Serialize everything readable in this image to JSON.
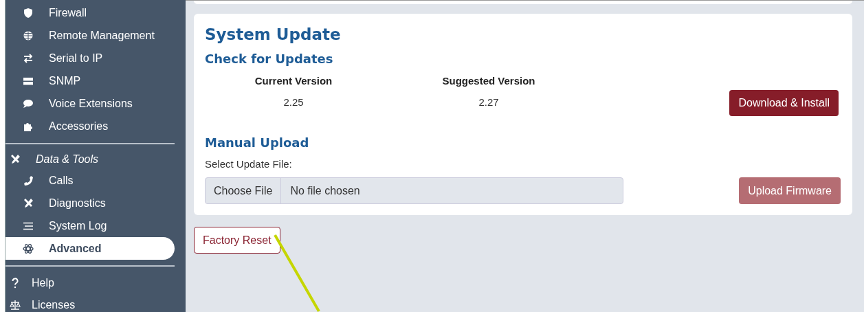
{
  "sidebar": {
    "sections": [
      {
        "items": [
          {
            "label": "Firewall",
            "selected": false
          },
          {
            "label": "Remote Management",
            "selected": false
          },
          {
            "label": "Serial to IP",
            "selected": false
          },
          {
            "label": "SNMP",
            "selected": false
          },
          {
            "label": "Voice Extensions",
            "selected": false
          },
          {
            "label": "Accessories",
            "selected": false
          }
        ]
      },
      {
        "header": "Data & Tools",
        "items": [
          {
            "label": "Calls",
            "selected": false
          },
          {
            "label": "Diagnostics",
            "selected": false
          },
          {
            "label": "System Log",
            "selected": false
          },
          {
            "label": "Advanced",
            "selected": true
          }
        ]
      },
      {
        "items": [
          {
            "label": "Help",
            "selected": false
          },
          {
            "label": "Licenses",
            "selected": false
          }
        ]
      }
    ]
  },
  "card": {
    "title": "System Update",
    "check": {
      "heading": "Check for Updates",
      "columns": [
        {
          "header": "Current Version",
          "value": "2.25"
        },
        {
          "header": "Suggested Version",
          "value": "2.27"
        }
      ],
      "button": {
        "label": "Download & Install",
        "disabled": false
      }
    },
    "manual": {
      "heading": "Manual Upload",
      "field_label": "Select Update File:",
      "file_button": "Choose File",
      "file_status": "No file chosen",
      "button": {
        "label": "Upload Firmware",
        "disabled": true
      }
    }
  },
  "factory_reset": {
    "label": "Factory Reset"
  },
  "annotation": {
    "kind": "line"
  }
}
